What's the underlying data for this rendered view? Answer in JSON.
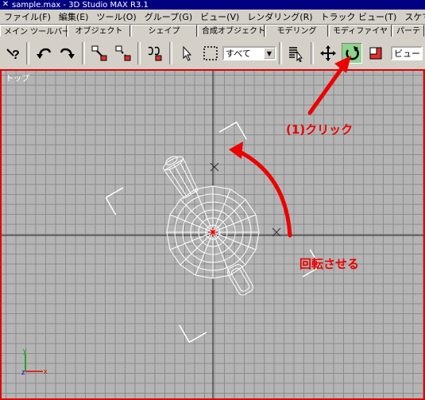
{
  "window": {
    "title": "sample.max - 3D Studio MAX R3.1"
  },
  "menu": [
    "ファイル(F)",
    "編集(E)",
    "ツール(O)",
    "グループ(G)",
    "ビュー(V)",
    "レンダリング(R)",
    "トラック ビュー(T)",
    "スケマティック ビュー(S)"
  ],
  "tabs": [
    "メイン ツールバー",
    "オブジェクト",
    "シェイプ",
    "合成オブジェクト",
    "モデリング",
    "モディファイヤ",
    "パーテ"
  ],
  "toolbar": {
    "selection_filter": "すべて",
    "coord_system": "ビュー",
    "icons": [
      "help-icon",
      "undo-icon",
      "redo-icon",
      "link-icon",
      "unlink-icon",
      "bind-spacewarp-icon",
      "select-icon",
      "region-select-icon",
      "select-by-name-icon",
      "move-icon",
      "rotate-icon",
      "scale-icon"
    ]
  },
  "viewport": {
    "label": "トップ"
  },
  "annotations": {
    "click": "(1)クリック",
    "rotate": "回転させる"
  },
  "colors": {
    "accent": "#ee0000",
    "active_tool": "#8ed38e",
    "title_bar": "#000080",
    "viewport_bg": "#b4b4b4"
  }
}
